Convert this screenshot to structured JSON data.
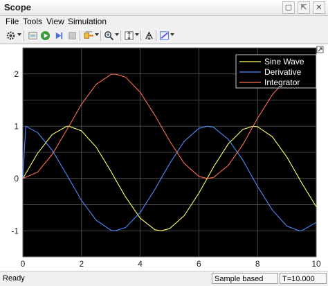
{
  "window": {
    "title": "Scope",
    "buttons": [
      "▢",
      "⇱",
      "✕"
    ]
  },
  "menu": [
    "File",
    "Tools",
    "View",
    "Simulation"
  ],
  "toolbar": {
    "icons": [
      "gear-icon",
      "open-file-icon",
      "run-icon",
      "step-forward-icon",
      "stop-icon",
      "signal-select-icon",
      "zoom-in-icon",
      "fit-axes-icon",
      "tune-icon",
      "style-icon"
    ]
  },
  "status": {
    "text": "Ready",
    "mode": "Sample based",
    "time": "T=10.000"
  },
  "chart_data": {
    "type": "line",
    "xlim": [
      0,
      10
    ],
    "ylim": [
      -1.5,
      2.5
    ],
    "xticks": [
      0,
      2,
      4,
      6,
      8,
      10
    ],
    "yticks": [
      -1,
      -0.5,
      0,
      0.5,
      1,
      1.5,
      2
    ],
    "ytick_labels": [
      "-1",
      "",
      "0",
      "",
      "1",
      "",
      "2"
    ],
    "grid": true,
    "legend_position": "top-right",
    "background": "#000000",
    "axis_color": "#ffffff",
    "series": [
      {
        "name": "Sine Wave",
        "color": "#ffff66",
        "x": [
          0,
          0.5,
          1,
          1.5,
          1.57,
          2,
          2.5,
          3,
          3.14,
          3.5,
          4,
          4.5,
          4.71,
          5,
          5.5,
          6,
          6.28,
          6.5,
          7,
          7.5,
          7.85,
          8,
          8.5,
          9,
          9.42,
          9.5,
          10
        ],
        "y": [
          0,
          0.48,
          0.84,
          1.0,
          1.0,
          0.91,
          0.6,
          0.14,
          0,
          -0.35,
          -0.76,
          -0.98,
          -1.0,
          -0.96,
          -0.71,
          -0.28,
          0,
          0.22,
          0.66,
          0.94,
          1.0,
          0.99,
          0.8,
          0.41,
          0,
          -0.08,
          -0.54
        ]
      },
      {
        "name": "Derivative",
        "color": "#4d8cff",
        "x": [
          0,
          0.1,
          0.5,
          1,
          1.5,
          1.57,
          2,
          2.5,
          3,
          3.14,
          3.5,
          4,
          4.5,
          4.71,
          5,
          5.5,
          6,
          6.28,
          6.5,
          7,
          7.5,
          7.85,
          8,
          8.5,
          9,
          9.42,
          9.5,
          10
        ],
        "y": [
          0,
          1.0,
          0.88,
          0.54,
          0.07,
          0,
          -0.42,
          -0.8,
          -0.99,
          -1.0,
          -0.94,
          -0.65,
          -0.21,
          0,
          0.28,
          0.71,
          0.96,
          1.0,
          0.98,
          0.75,
          0.35,
          0,
          -0.15,
          -0.6,
          -0.91,
          -1.0,
          -1.0,
          -0.84
        ]
      },
      {
        "name": "Integrator",
        "color": "#ff6f4d",
        "x": [
          0,
          0.5,
          1,
          1.5,
          2,
          2.5,
          3,
          3.14,
          3.5,
          4,
          4.5,
          5,
          5.5,
          6,
          6.28,
          6.5,
          7,
          7.5,
          8,
          8.5,
          9,
          9.42,
          9.5,
          10
        ],
        "y": [
          0,
          0.12,
          0.46,
          0.93,
          1.42,
          1.8,
          1.99,
          2.0,
          1.94,
          1.65,
          1.21,
          0.72,
          0.29,
          0.04,
          0,
          0.02,
          0.25,
          0.65,
          1.15,
          1.6,
          1.91,
          2.0,
          2.0,
          1.84
        ]
      }
    ]
  }
}
